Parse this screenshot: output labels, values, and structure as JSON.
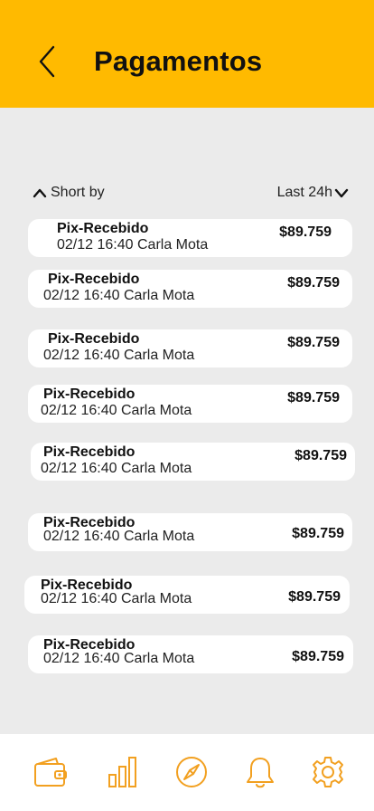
{
  "header": {
    "title": "Pagamentos"
  },
  "sort": {
    "left_label": "Short by",
    "right_label": "Last 24h"
  },
  "payments": [
    {
      "title": "Pix-Recebido",
      "datetime": "02/12 16:40",
      "name": "Carla Mota",
      "amount": "$89.759"
    },
    {
      "title": "Pix-Recebido",
      "datetime": "02/12 16:40",
      "name": "Carla Mota",
      "amount": "$89.759"
    },
    {
      "title": "Pix-Recebido",
      "datetime": "02/12 16:40",
      "name": "Carla Mota",
      "amount": "$89.759"
    },
    {
      "title": "Pix-Recebido",
      "datetime": "02/12 16:40",
      "name": "Carla Mota",
      "amount": "$89.759"
    },
    {
      "title": "Pix-Recebido",
      "datetime": "02/12 16:40",
      "name": "Carla Mota",
      "amount": "$89.759"
    },
    {
      "title": "Pix-Recebido",
      "datetime": "02/12 16:40",
      "name": "Carla Mota",
      "amount": "$89.759"
    },
    {
      "title": "Pix-Recebido",
      "datetime": "02/12 16:40",
      "name": "Carla Mota",
      "amount": "$89.759"
    },
    {
      "title": "Pix-Recebido",
      "datetime": "02/12 16:40",
      "name": "Carla Mota",
      "amount": "$89.759"
    }
  ],
  "nav": {
    "items": [
      {
        "icon": "wallet-icon"
      },
      {
        "icon": "bar-chart-icon"
      },
      {
        "icon": "compass-icon"
      },
      {
        "icon": "bell-icon"
      },
      {
        "icon": "gear-icon"
      }
    ],
    "accent_color": "#f2a020"
  },
  "colors": {
    "header": "#ffba00",
    "background": "#ebebeb",
    "card": "#ffffff"
  }
}
